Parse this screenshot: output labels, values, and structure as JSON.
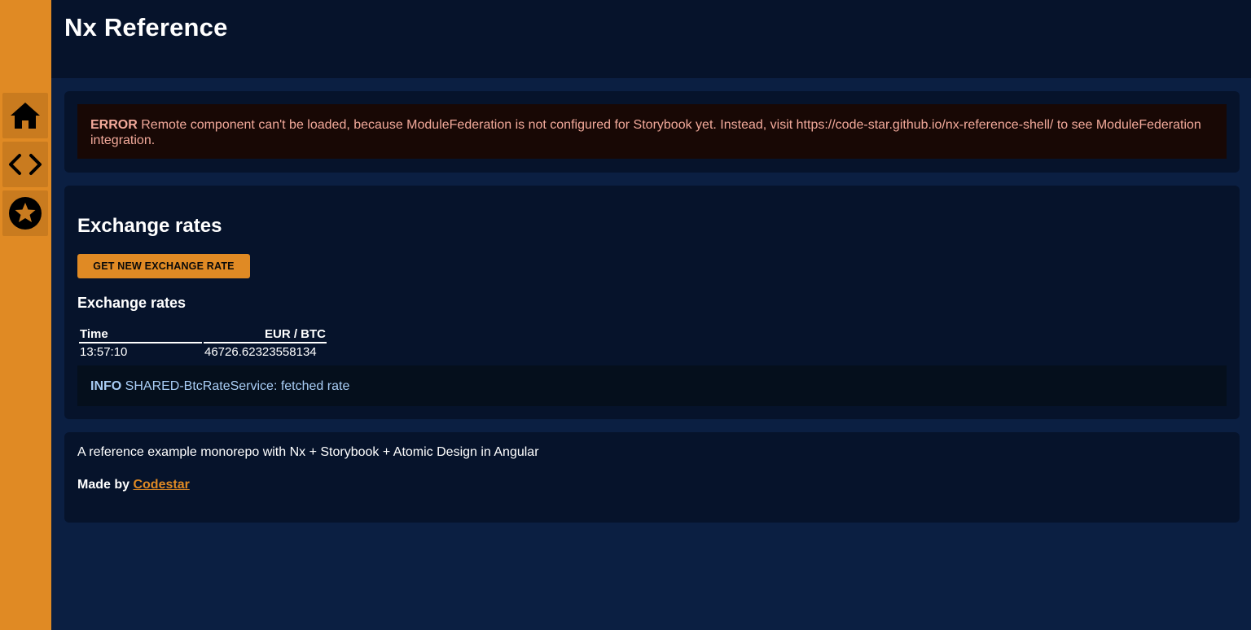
{
  "app": {
    "title": "Nx Reference"
  },
  "nav": {
    "items": [
      {
        "icon": "home-icon"
      },
      {
        "icon": "code-icon"
      },
      {
        "icon": "star-icon"
      }
    ]
  },
  "error": {
    "level": "ERROR",
    "message": "Remote component can't be loaded, because ModuleFederation is not configured for Storybook yet. Instead, visit https://code-star.github.io/nx-reference-shell/ to see ModuleFederation integration."
  },
  "rates": {
    "title": "Exchange rates",
    "button_label": "GET NEW EXCHANGE RATE",
    "table_title": "Exchange rates",
    "columns": [
      "Time",
      "EUR / BTC"
    ],
    "rows": [
      [
        "13:57:10",
        "46726.62323558134"
      ]
    ]
  },
  "info": {
    "level": "INFO",
    "message": "SHARED-BtcRateService: fetched rate"
  },
  "footer": {
    "description": "A reference example monorepo with Nx + Storybook + Atomic Design in Angular",
    "made_by": "Made by",
    "link_text": "Codestar"
  },
  "colors": {
    "accent": "#e08a24",
    "background": "#0b1f42",
    "card": "#06132b",
    "error_text": "#f2a99a",
    "info_text": "#a9cdf5"
  }
}
